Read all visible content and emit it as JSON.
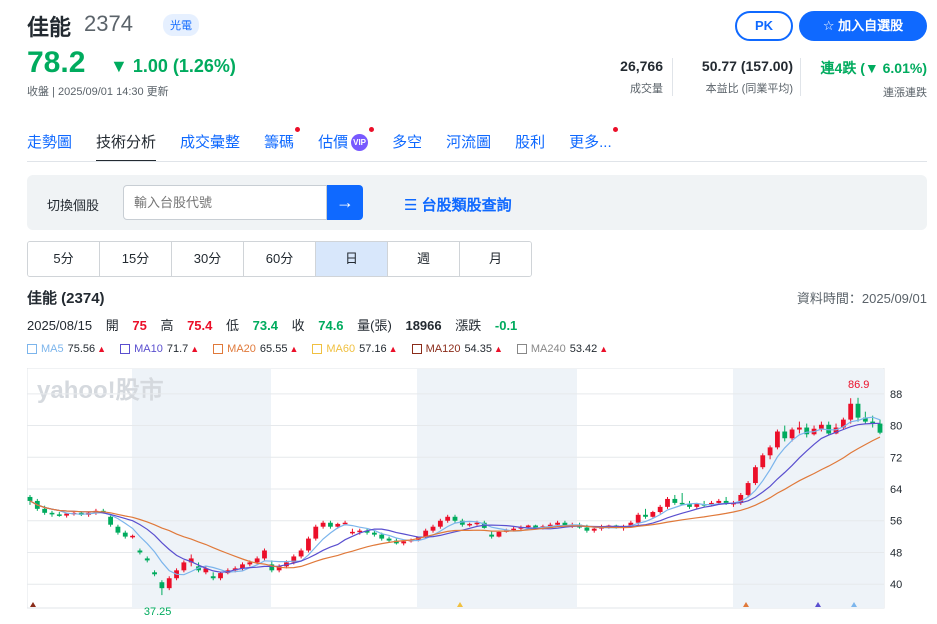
{
  "header": {
    "name": "佳能",
    "code": "2374",
    "industry": "光電",
    "pk_label": "PK",
    "add_label": "☆  加入自選股"
  },
  "quote": {
    "price": "78.2",
    "change": "▼ 1.00 (1.26%)",
    "status": "收盤 | 2025/09/01 14:30 更新"
  },
  "stats": [
    {
      "value": "26,766",
      "label": "成交量",
      "color": "#232a31"
    },
    {
      "value": "50.77 (157.00)",
      "label": "本益比 (同業平均)",
      "color": "#232a31"
    },
    {
      "value": "連4跌 (▼ 6.01%)",
      "label": "連漲連跌",
      "color": "#00ab5e"
    }
  ],
  "tabs": [
    {
      "label": "走勢圖",
      "dot": false,
      "vip": false
    },
    {
      "label": "技術分析",
      "dot": false,
      "vip": false,
      "active": true
    },
    {
      "label": "成交彙整",
      "dot": false,
      "vip": false
    },
    {
      "label": "籌碼",
      "dot": true,
      "vip": false
    },
    {
      "label": "估價",
      "dot": true,
      "vip": true
    },
    {
      "label": "多空",
      "dot": false,
      "vip": false
    },
    {
      "label": "河流圖",
      "dot": false,
      "vip": false
    },
    {
      "label": "股利",
      "dot": false,
      "vip": false
    },
    {
      "label": "更多...",
      "dot": true,
      "vip": false
    }
  ],
  "search": {
    "label": "切換個股",
    "placeholder": "輸入台股代號",
    "link": "☰ 台股類股查詢"
  },
  "periods": [
    "5分",
    "15分",
    "30分",
    "60分",
    "日",
    "週",
    "月"
  ],
  "active_period": "日",
  "chart_header": {
    "name": "佳能 (2374)",
    "data_time": "資料時間：2025/09/01"
  },
  "ohlc": {
    "date": "2025/08/15",
    "open_label": "開",
    "open": "75",
    "high_label": "高",
    "high": "75.4",
    "low_label": "低",
    "low": "73.4",
    "close_label": "收",
    "close": "74.6",
    "vol_label": "量(張)",
    "vol": "18966",
    "chg_label": "漲跌",
    "chg": "-0.1"
  },
  "ma_legend": [
    {
      "label": "MA5",
      "value": "75.56",
      "color": "#7cb5ec"
    },
    {
      "label": "MA10",
      "value": "71.7",
      "color": "#5a4fcf"
    },
    {
      "label": "MA20",
      "value": "65.55",
      "color": "#e0793a"
    },
    {
      "label": "MA60",
      "value": "57.16",
      "color": "#f0c040"
    },
    {
      "label": "MA120",
      "value": "54.35",
      "color": "#8b2c1a"
    },
    {
      "label": "MA240",
      "value": "53.42",
      "color": "#888888"
    }
  ],
  "chart_data": {
    "type": "candlestick",
    "watermark": "yahoo!股市",
    "y_ticks": [
      40,
      48,
      56,
      64,
      72,
      80,
      88
    ],
    "ylim": [
      34,
      93
    ],
    "max_label": "86.9",
    "min_label": "37.25",
    "candles": [
      [
        62,
        62.5,
        60,
        61
      ],
      [
        61,
        61.5,
        58.5,
        59
      ],
      [
        59,
        59.8,
        57.5,
        58
      ],
      [
        58,
        58.5,
        57,
        57.6
      ],
      [
        57.6,
        58.2,
        57,
        57.3
      ],
      [
        57.3,
        58,
        56.8,
        57.8
      ],
      [
        57.8,
        58.5,
        57.3,
        58
      ],
      [
        58,
        58.4,
        57.2,
        57.5
      ],
      [
        57.5,
        58.2,
        57,
        58
      ],
      [
        58,
        59,
        57.5,
        58.5
      ],
      [
        58.5,
        59,
        57.8,
        58.2
      ],
      [
        57,
        57.5,
        54.5,
        55
      ],
      [
        54.5,
        55,
        52.5,
        53
      ],
      [
        53,
        53.5,
        51.5,
        52
      ],
      [
        52,
        52.5,
        51.5,
        52.2
      ],
      [
        48.5,
        49,
        47.5,
        48
      ],
      [
        46.5,
        47,
        45.5,
        46
      ],
      [
        43,
        43.5,
        42,
        42.5
      ],
      [
        40.5,
        41,
        37.25,
        39
      ],
      [
        39,
        42,
        38.5,
        41.5
      ],
      [
        41.5,
        44,
        41,
        43.5
      ],
      [
        43.5,
        46,
        43,
        45.5
      ],
      [
        45.5,
        47.5,
        44.5,
        46.5
      ],
      [
        44.5,
        45.5,
        43,
        43.5
      ],
      [
        43,
        44.5,
        42.5,
        44
      ],
      [
        42,
        43,
        41,
        41.5
      ],
      [
        41.5,
        43,
        41,
        42.8
      ],
      [
        42.8,
        44,
        42.5,
        43.5
      ],
      [
        43.5,
        44.5,
        43,
        44
      ],
      [
        44,
        45.5,
        43.5,
        45
      ],
      [
        45,
        46,
        44.5,
        45.5
      ],
      [
        45.5,
        47,
        45,
        46.5
      ],
      [
        46.5,
        49,
        46,
        48.5
      ],
      [
        45,
        46,
        43,
        43.5
      ],
      [
        43.5,
        45,
        43,
        44.5
      ],
      [
        44.5,
        46,
        44,
        45.5
      ],
      [
        45.5,
        47.5,
        45,
        47
      ],
      [
        47,
        49,
        46.5,
        48.5
      ],
      [
        48.5,
        52,
        48,
        51.5
      ],
      [
        51.5,
        55,
        51,
        54.5
      ],
      [
        54.5,
        56,
        54,
        55.5
      ],
      [
        55.5,
        56,
        54,
        54.5
      ],
      [
        54.5,
        55.5,
        54,
        55.2
      ],
      [
        55.2,
        56,
        54.8,
        55.5
      ],
      [
        53,
        54,
        52.5,
        53.2
      ],
      [
        53.2,
        54,
        52.5,
        53.5
      ],
      [
        53.5,
        54,
        52.5,
        53
      ],
      [
        53,
        53.5,
        52,
        52.5
      ],
      [
        52.5,
        53,
        51,
        51.5
      ],
      [
        51.5,
        52,
        50.5,
        51
      ],
      [
        51,
        51.5,
        50,
        50.3
      ],
      [
        50.3,
        51,
        49.8,
        50.8
      ],
      [
        50.8,
        51.5,
        50.5,
        51.2
      ],
      [
        51.2,
        52,
        50.8,
        51.8
      ],
      [
        51.8,
        54,
        51.5,
        53.5
      ],
      [
        53.5,
        55,
        53,
        54.5
      ],
      [
        54.5,
        56.5,
        54,
        56
      ],
      [
        56,
        57.5,
        55.5,
        57
      ],
      [
        57,
        57.5,
        55.5,
        56
      ],
      [
        56,
        56.5,
        54.5,
        55
      ],
      [
        55,
        55.5,
        54.5,
        55.2
      ],
      [
        55.2,
        56,
        54.8,
        55.5
      ],
      [
        55.5,
        56,
        54,
        54.2
      ],
      [
        52.5,
        53.5,
        51.5,
        52
      ],
      [
        52,
        53.5,
        51.8,
        53.2
      ],
      [
        53.2,
        54,
        53,
        53.6
      ],
      [
        53.6,
        54.5,
        53.3,
        54
      ],
      [
        54,
        54.8,
        53.5,
        54.4
      ],
      [
        54.4,
        55,
        54,
        54.8
      ],
      [
        54.8,
        55,
        53.8,
        54
      ],
      [
        54,
        55,
        53.8,
        54.6
      ],
      [
        54.6,
        55.5,
        54.2,
        55
      ],
      [
        55,
        56,
        54.5,
        55.5
      ],
      [
        55.5,
        56,
        54.5,
        54.8
      ],
      [
        54.8,
        55.5,
        54.2,
        55
      ],
      [
        55,
        55.5,
        54,
        54.3
      ],
      [
        54.3,
        55,
        53,
        53.5
      ],
      [
        53.5,
        54.5,
        53,
        54
      ],
      [
        54,
        55,
        53.5,
        54.5
      ],
      [
        54.5,
        55,
        54,
        54.8
      ],
      [
        54.8,
        55,
        54,
        54.3
      ],
      [
        54.3,
        55,
        53.5,
        54.7
      ],
      [
        54.7,
        56,
        54.5,
        55.5
      ],
      [
        55.5,
        58,
        55,
        57.5
      ],
      [
        57.5,
        59,
        56.5,
        57
      ],
      [
        57,
        58.5,
        56.8,
        58.2
      ],
      [
        58.2,
        60,
        57.8,
        59.5
      ],
      [
        59.5,
        62,
        59,
        61.5
      ],
      [
        61.5,
        62.5,
        60,
        60.5
      ],
      [
        60.5,
        63,
        60,
        60.2
      ],
      [
        60.2,
        61,
        59,
        59.5
      ],
      [
        59.5,
        60.5,
        59,
        60.2
      ],
      [
        60.2,
        61,
        59.5,
        60
      ],
      [
        60,
        61,
        59.8,
        60.5
      ],
      [
        60.5,
        61.5,
        60,
        61
      ],
      [
        61,
        62,
        60,
        60.3
      ],
      [
        60.3,
        61,
        59.5,
        60.5
      ],
      [
        60.5,
        63,
        60,
        62.5
      ],
      [
        62.5,
        66,
        62,
        65.5
      ],
      [
        65.5,
        70,
        65,
        69.5
      ],
      [
        69.5,
        73,
        69,
        72.5
      ],
      [
        72.5,
        75,
        71.5,
        74.5
      ],
      [
        74.5,
        79,
        74,
        78.5
      ],
      [
        78.5,
        80,
        76,
        76.8
      ],
      [
        76.8,
        79.5,
        76,
        79
      ],
      [
        79,
        81,
        78,
        79.5
      ],
      [
        79.5,
        80.5,
        77,
        77.8
      ],
      [
        77.8,
        80,
        77.5,
        79.2
      ],
      [
        79.2,
        81,
        78.5,
        80.2
      ],
      [
        80.2,
        81,
        77.5,
        78
      ],
      [
        78,
        80.5,
        77.8,
        79.5
      ],
      [
        79.5,
        82,
        79,
        81.5
      ],
      [
        81.5,
        86.9,
        80.5,
        85.5
      ],
      [
        85.5,
        87,
        81,
        82
      ],
      [
        82,
        83.5,
        80.5,
        81
      ],
      [
        81,
        82.5,
        79.5,
        80.5
      ],
      [
        80.5,
        81.5,
        77.8,
        78.2
      ]
    ]
  }
}
